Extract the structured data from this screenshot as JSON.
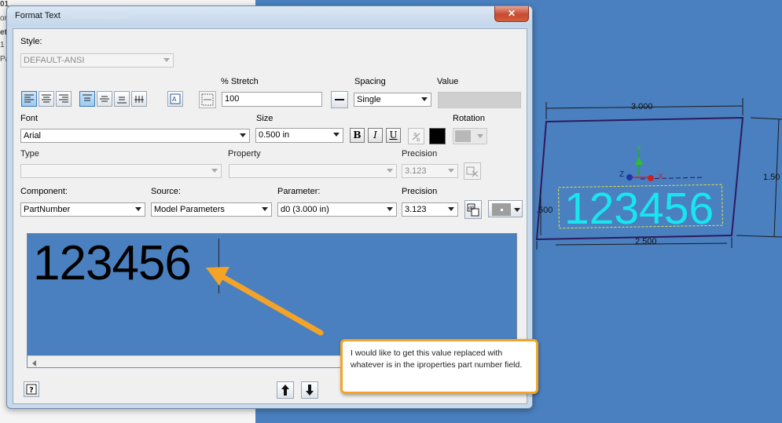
{
  "background_app": {
    "left_lines": [
      "01",
      "on",
      "et",
      "1",
      "Pa"
    ]
  },
  "dialog": {
    "title": "Format Text",
    "close_label": "✕",
    "style": {
      "label": "Style:",
      "value": "DEFAULT-ANSI"
    },
    "stretch": {
      "label": "% Stretch",
      "value": "100"
    },
    "spacing": {
      "label": "Spacing",
      "value": "Single"
    },
    "value": {
      "label": "Value",
      "text": ""
    },
    "font": {
      "label": "Font",
      "value": "Arial"
    },
    "size": {
      "label": "Size",
      "value": "0.500 in"
    },
    "bold_label": "B",
    "italic_label": "I",
    "underline_label": "U",
    "rotation": {
      "label": "Rotation"
    },
    "type": {
      "label": "Type",
      "value": ""
    },
    "property": {
      "label": "Property",
      "value": ""
    },
    "precision_top": {
      "label": "Precision",
      "value": "3.123"
    },
    "component": {
      "label": "Component:",
      "value": "PartNumber"
    },
    "source": {
      "label": "Source:",
      "value": "Model Parameters"
    },
    "parameter": {
      "label": "Parameter:",
      "value": "d0 (3.000 in)"
    },
    "precision_bottom": {
      "label": "Precision",
      "value": "3.123"
    },
    "preview_text": "123456",
    "help_label": "?"
  },
  "model": {
    "text": "123456",
    "dim_top": "3.000",
    "dim_bottom": "2.500",
    "dim_left": ".500",
    "dim_right": "1.50",
    "axis_y": "Y",
    "axis_z": "Z",
    "axis_x": "X"
  },
  "callout": {
    "text": "I would like to get this value replaced with whatever is in the iproperties part number field."
  },
  "colors": {
    "canvas": "#4a80c0",
    "model_text": "#18e6ef",
    "callout_border": "#f3a428",
    "arrow": "#f3a428"
  }
}
